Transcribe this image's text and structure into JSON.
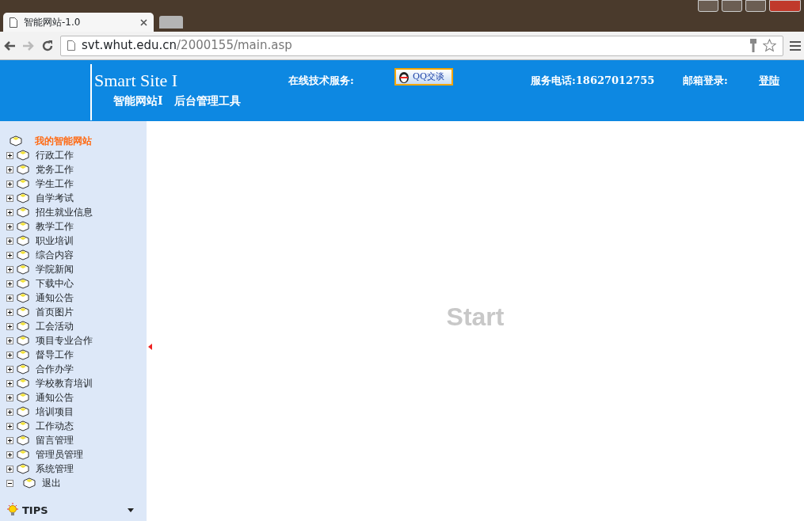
{
  "browser": {
    "tab_title": "智能网站-1.0",
    "url_host": "svt.whut.edu.cn",
    "url_path": "/2000155/main.asp"
  },
  "header": {
    "logo_title": "Smart Site I",
    "logo_subtitle": "智能网站I　后台管理工具",
    "service_label": "在线技术服务:",
    "qq_button": "QQ交谈",
    "phone": "服务电话:18627012755",
    "mail_label": "邮箱登录:",
    "login_link": "登陆"
  },
  "sidebar": {
    "root": "我的智能网站",
    "items": [
      {
        "label": "行政工作",
        "kind": "folder"
      },
      {
        "label": "党务工作",
        "kind": "folder"
      },
      {
        "label": "学生工作",
        "kind": "folder"
      },
      {
        "label": "自学考试",
        "kind": "folder"
      },
      {
        "label": "招生就业信息",
        "kind": "folder"
      },
      {
        "label": "教学工作",
        "kind": "folder"
      },
      {
        "label": "职业培训",
        "kind": "folder"
      },
      {
        "label": "综合内容",
        "kind": "folder"
      },
      {
        "label": "学院新闻",
        "kind": "folder"
      },
      {
        "label": "下载中心",
        "kind": "folder"
      },
      {
        "label": "通知公告",
        "kind": "folder"
      },
      {
        "label": "首页图片",
        "kind": "folder"
      },
      {
        "label": "工会活动",
        "kind": "folder"
      },
      {
        "label": "项目专业合作",
        "kind": "folder"
      },
      {
        "label": "督导工作",
        "kind": "folder"
      },
      {
        "label": "合作办学",
        "kind": "folder"
      },
      {
        "label": "学校教育培训",
        "kind": "folder"
      },
      {
        "label": "通知公告",
        "kind": "folder"
      },
      {
        "label": "培训项目",
        "kind": "folder"
      },
      {
        "label": "工作动态",
        "kind": "folder"
      },
      {
        "label": "留言管理",
        "kind": "folder"
      },
      {
        "label": "管理员管理",
        "kind": "folder"
      },
      {
        "label": "系统管理",
        "kind": "folder"
      },
      {
        "label": "退出",
        "kind": "leaf"
      }
    ],
    "tips": "TIPS"
  },
  "main": {
    "start": "Start"
  }
}
